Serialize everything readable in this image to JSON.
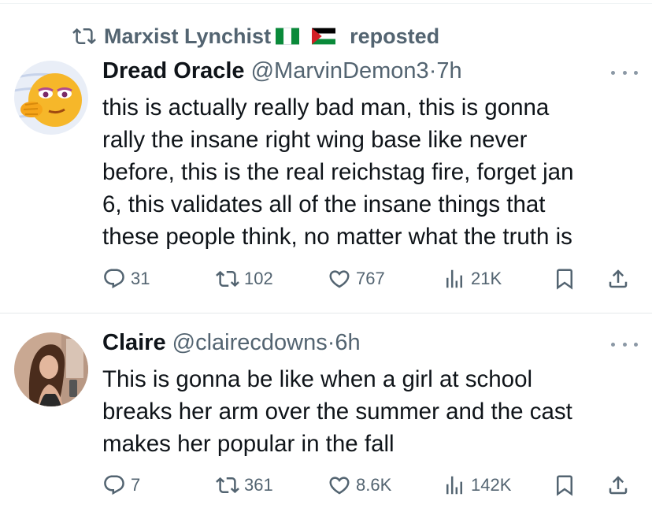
{
  "repost": {
    "user": "Marxist Lynchist",
    "label": "reposted",
    "icon": "repost-icon",
    "flags": [
      "nigeria-flag",
      "palestine-flag"
    ]
  },
  "tweets": [
    {
      "name": "Dread Oracle",
      "handle": "@MarvinDemon3",
      "sep": "·",
      "time": "7h",
      "lines": [
        "this is actually really bad man, this is gonna",
        "rally the insane right wing base like never",
        "before, this is the real reichstag fire, forget jan",
        "6, this validates all of the insane things that",
        "these people think, no matter what the truth is"
      ],
      "replies": "31",
      "reposts": "102",
      "likes": "767",
      "views": "21K"
    },
    {
      "name": "Claire",
      "handle": "@clairecdowns",
      "sep": "·",
      "time": "6h",
      "lines": [
        "This is gonna be like when a girl at school",
        "breaks her arm over the summer and the cast",
        "makes her popular in the fall"
      ],
      "replies": "7",
      "reposts": "361",
      "likes": "8.6K",
      "views": "142K"
    }
  ],
  "colors": {
    "text": "#0f1419",
    "muted": "#536471",
    "divider": "#e6e9eb"
  }
}
